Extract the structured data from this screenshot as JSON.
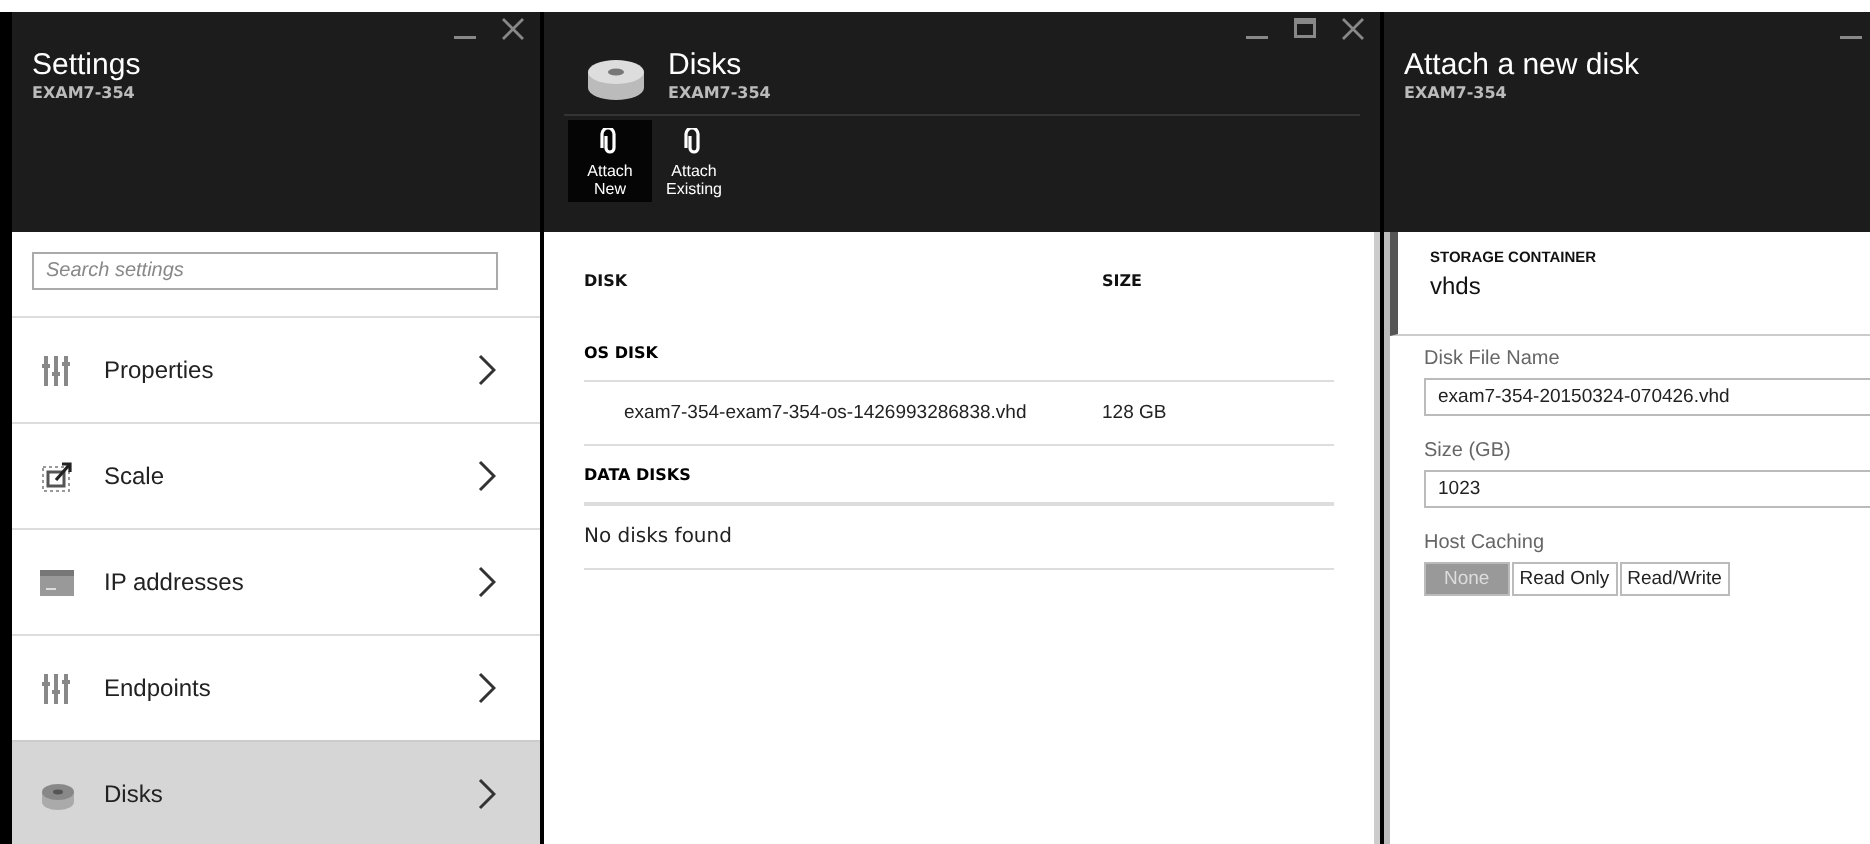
{
  "blades": [
    {
      "kind": "settings",
      "title": "Settings",
      "subtitle": "EXAM7-354",
      "search": {
        "placeholder": "Search settings"
      },
      "items": [
        {
          "label": "Properties",
          "selected": false
        },
        {
          "label": "Scale",
          "selected": false
        },
        {
          "label": "IP addresses",
          "selected": false
        },
        {
          "label": "Endpoints",
          "selected": false
        },
        {
          "label": "Disks",
          "selected": true
        }
      ]
    },
    {
      "kind": "disks",
      "title": "Disks",
      "subtitle": "EXAM7-354",
      "commands": [
        {
          "label": "Attach New",
          "selected": true
        },
        {
          "label": "Attach Existing",
          "selected": false
        }
      ],
      "columns": [
        "DISK",
        "SIZE"
      ],
      "sections": [
        {
          "heading": "OS DISK",
          "rows": [
            {
              "disk": "exam7-354-exam7-354-os-1426993286838.vhd",
              "size": "128 GB"
            }
          ]
        },
        {
          "heading": "DATA DISKS",
          "empty": "No disks found"
        }
      ]
    },
    {
      "kind": "attach",
      "title": "Attach a new disk",
      "subtitle": "EXAM7-354",
      "container": {
        "label": "STORAGE CONTAINER",
        "value": "vhds"
      },
      "fields": [
        {
          "kind": "dropdown",
          "label": "Disk File Name",
          "value": "exam7-354-20150324-070426.vhd"
        },
        {
          "kind": "text",
          "label": "Size (GB)",
          "value": "1023"
        },
        {
          "kind": "segmented",
          "label": "Host Caching",
          "options": [
            {
              "label": "None",
              "selected": true
            },
            {
              "label": "Read Only",
              "selected": false
            },
            {
              "label": "Read/Write",
              "selected": false
            }
          ]
        }
      ]
    }
  ]
}
